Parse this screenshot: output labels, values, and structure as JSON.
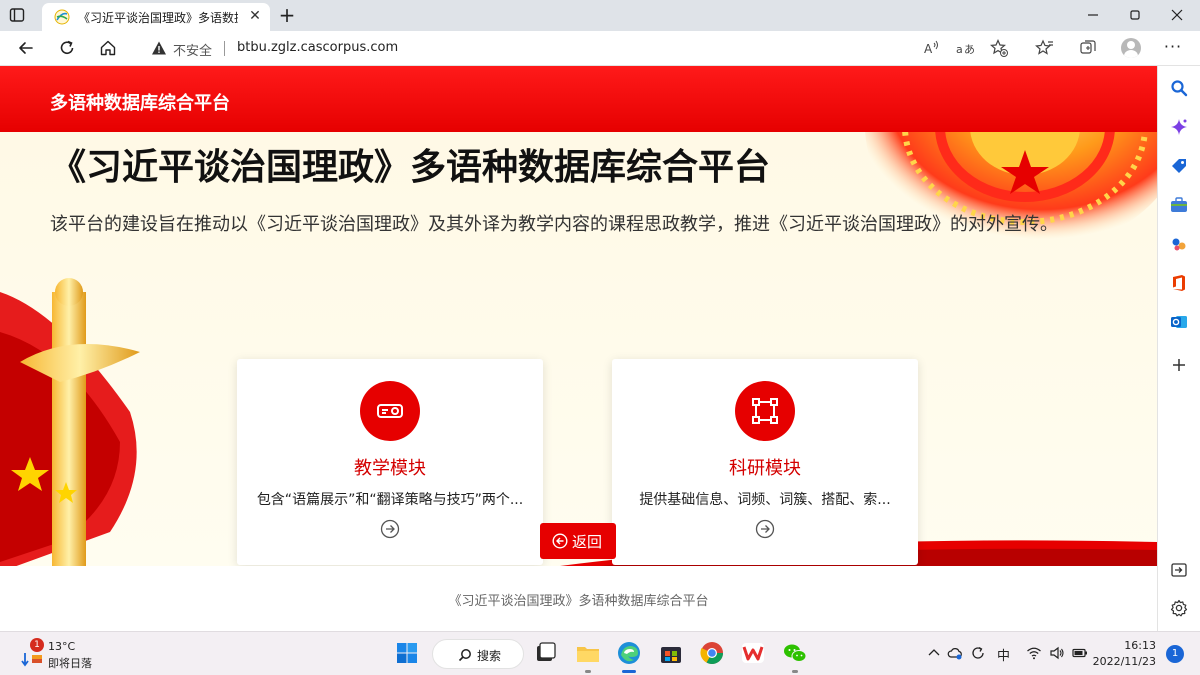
{
  "browser": {
    "tab_title": "《习近平谈治国理政》多语数据",
    "address": {
      "security_label": "不安全",
      "url": "btbu.zglz.cascorpus.com"
    }
  },
  "site": {
    "header_name": "多语种数据库综合平台",
    "banner_title": "《习近平谈治国理政》多语种数据库综合平台",
    "banner_description": "该平台的建设旨在推动以《习近平谈治国理政》及其外译为教学内容的课程思政教学，推进《习近平谈治国理政》的对外宣传。",
    "cards": [
      {
        "title": "教学模块",
        "description": "包含“语篇展示”和“翻译策略与技巧”两个...",
        "icon": "projector-icon"
      },
      {
        "title": "科研模块",
        "description": "提供基础信息、词频、词簇、搭配、索...",
        "icon": "nodes-icon"
      }
    ],
    "back_label": "返回",
    "footer": "《习近平谈治国理政》多语种数据库综合平台"
  },
  "taskbar": {
    "weather_badge": "1",
    "temperature": "13°C",
    "weather_desc": "即将日落",
    "search_label": "搜索",
    "ime": "中",
    "time": "16:13",
    "date": "2022/11/23",
    "notification_count": "1"
  },
  "colors": {
    "brand_red": "#e60000",
    "banner_bg": "#fff9e6",
    "accent_blue": "#1a66d6"
  }
}
